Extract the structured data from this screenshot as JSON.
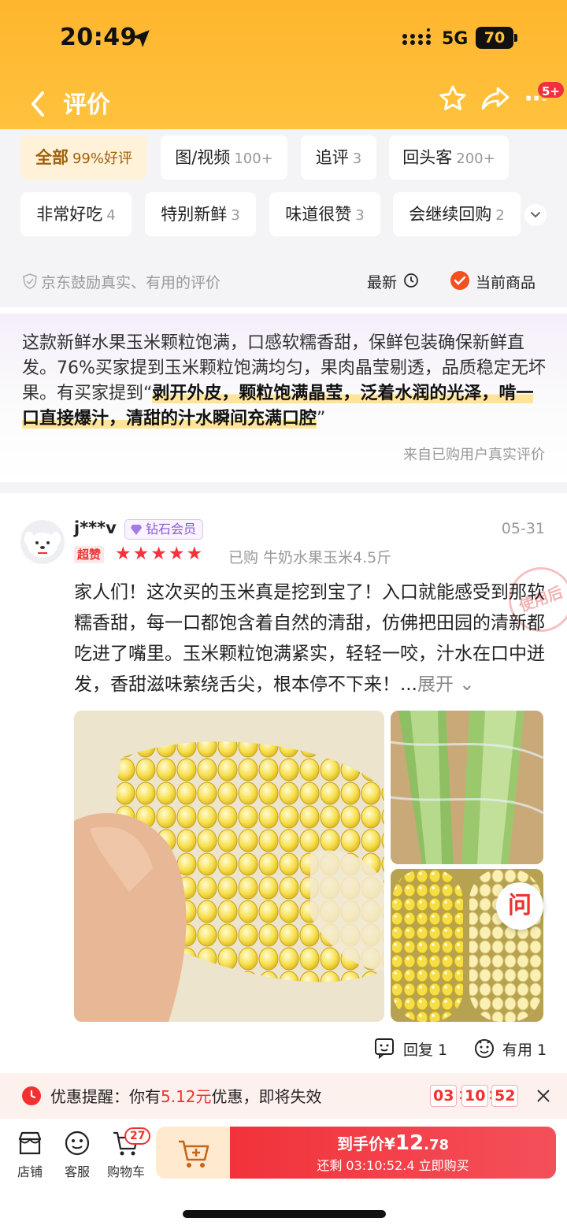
{
  "status_bar": {
    "time": "20:49",
    "network": "5G",
    "battery": "70"
  },
  "nav": {
    "title": "评价",
    "message_badge": "5+"
  },
  "filters": {
    "row1": [
      {
        "label": "全部",
        "count": "99%好评",
        "active": true
      },
      {
        "label": "图/视频",
        "count": "100+"
      },
      {
        "label": "追评",
        "count": "3"
      },
      {
        "label": "回头客",
        "count": "200+"
      }
    ],
    "row2": [
      {
        "label": "非常好吃",
        "count": "4"
      },
      {
        "label": "特别新鲜",
        "count": "3"
      },
      {
        "label": "味道很赞",
        "count": "3"
      },
      {
        "label": "会继续回购",
        "count": "2"
      }
    ],
    "encourage": "京东鼓励真实、有用的评价",
    "sort": "最新",
    "current_product": "当前商品"
  },
  "summary": {
    "text_before": "这款新鲜水果玉米颗粒饱满，口感软糯香甜，保鲜包装确保新鲜直发。76%买家提到玉米颗粒饱满均匀，果肉晶莹剔透，品质稳定无坏果。有买家提到“",
    "highlight": "剥开外皮，颗粒饱满晶莹，泛着水润的光泽，啃一口直接爆汁，清甜的汁水瞬间充满口腔",
    "text_after": "”",
    "source": "来自已购用户真实评价"
  },
  "review": {
    "user": "j***v",
    "member_badge": "钻石会员",
    "date": "05-31",
    "super_tag": "超赞",
    "rating": 5,
    "stars": "★★★★★",
    "bought": "已购 牛奶水果玉米4.5斤",
    "content": "家人们！这次买的玉米真是挖到宝了！入口就能感受到那软糯香甜，每一口都饱含着自然的清甜，仿佛把田园的清新都吃进了嘴里。玉米颗粒饱满紧实，轻轻一咬，汁水在口中迸发，香甜滋味萦绕舌尖，根本停不下来！...",
    "expand": "展开",
    "stamp": "使用后",
    "ask_label": "问",
    "reply": "回复 1",
    "useful": "有用 1"
  },
  "promo": {
    "prefix": "优惠提醒：你有",
    "amount": "5.12元",
    "suffix": "优惠，即将失效",
    "hh": "03",
    "mm": "10",
    "ss": "52"
  },
  "bottom_bar": {
    "shop": "店铺",
    "service": "客服",
    "cart": "购物车",
    "cart_count": "27",
    "buy_prefix": "到手价",
    "buy_currency": "¥",
    "buy_int": "12",
    "buy_dec": ".78",
    "buy_countdown": "还剩 03:10:52.4 立即购买"
  },
  "colors": {
    "accent": "#f23030",
    "header": "#ffc23d",
    "star": "#f4333c"
  }
}
